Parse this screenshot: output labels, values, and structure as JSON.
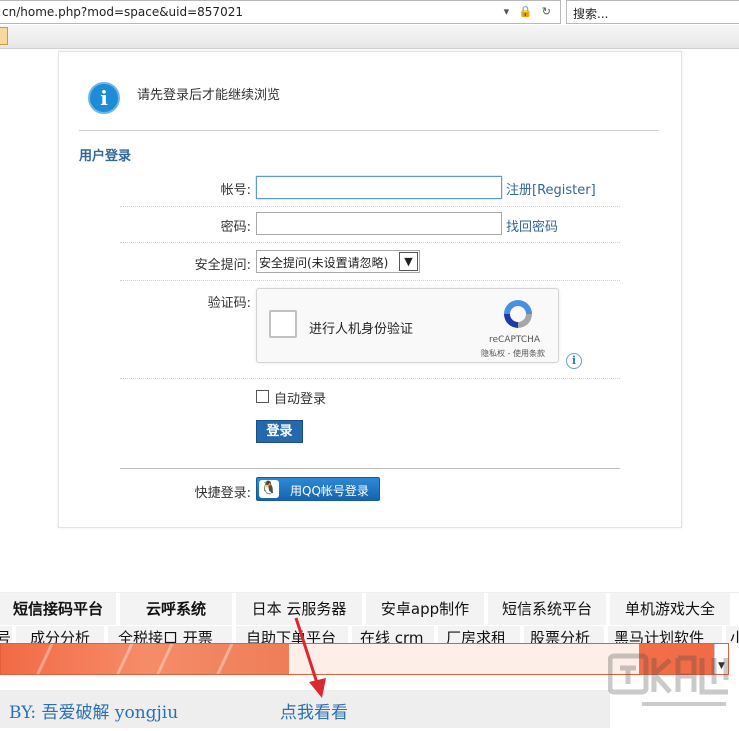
{
  "browser": {
    "url": "cn/home.php?mod=space&uid=857021",
    "url_controls": "▾ 🔒 ↻",
    "search_placeholder": "搜索..."
  },
  "notice": {
    "icon": "info-icon",
    "text": "请先登录后才能继续浏览"
  },
  "login": {
    "section_title": "用户登录",
    "account_label": "帐号:",
    "register_link": "注册[Register]",
    "password_label": "密码:",
    "forgot_link": "找回密码",
    "security_label": "安全提问:",
    "security_selected": "安全提问(未设置请忽略)",
    "captcha_label": "验证码:",
    "recaptcha_text": "进行人机身份验证",
    "recaptcha_brand": "reCAPTCHA",
    "recaptcha_terms": "隐私权 - 使用条款",
    "remember_label": "自动登录",
    "login_button": "登录",
    "quick_login_label": "快捷登录:",
    "qq_button": "用QQ帐号登录"
  },
  "links_row1": [
    {
      "label": "短信接码平台",
      "bold": true
    },
    {
      "label": "云呼系统",
      "bold": true
    },
    {
      "label": "日本 云服务器",
      "bold": false
    },
    {
      "label": "安卓app制作",
      "bold": false
    },
    {
      "label": "短信系统平台",
      "bold": false
    },
    {
      "label": "单机游戏大全",
      "bold": false
    }
  ],
  "links_row2": [
    "号",
    "成分分析",
    "全税接口 开票",
    "自助下单平台",
    "在线 crm",
    "厂房求租",
    "股票分析",
    "黑马计划软件",
    "小"
  ],
  "caption": {
    "by": "BY: 吾爱破解 yongjiu",
    "click_me": "点我看看"
  },
  "colors": {
    "link_blue": "#336699",
    "button_blue": "#2469ad",
    "banner_orange": "#f26a45",
    "arrow_red": "#d9282f"
  }
}
